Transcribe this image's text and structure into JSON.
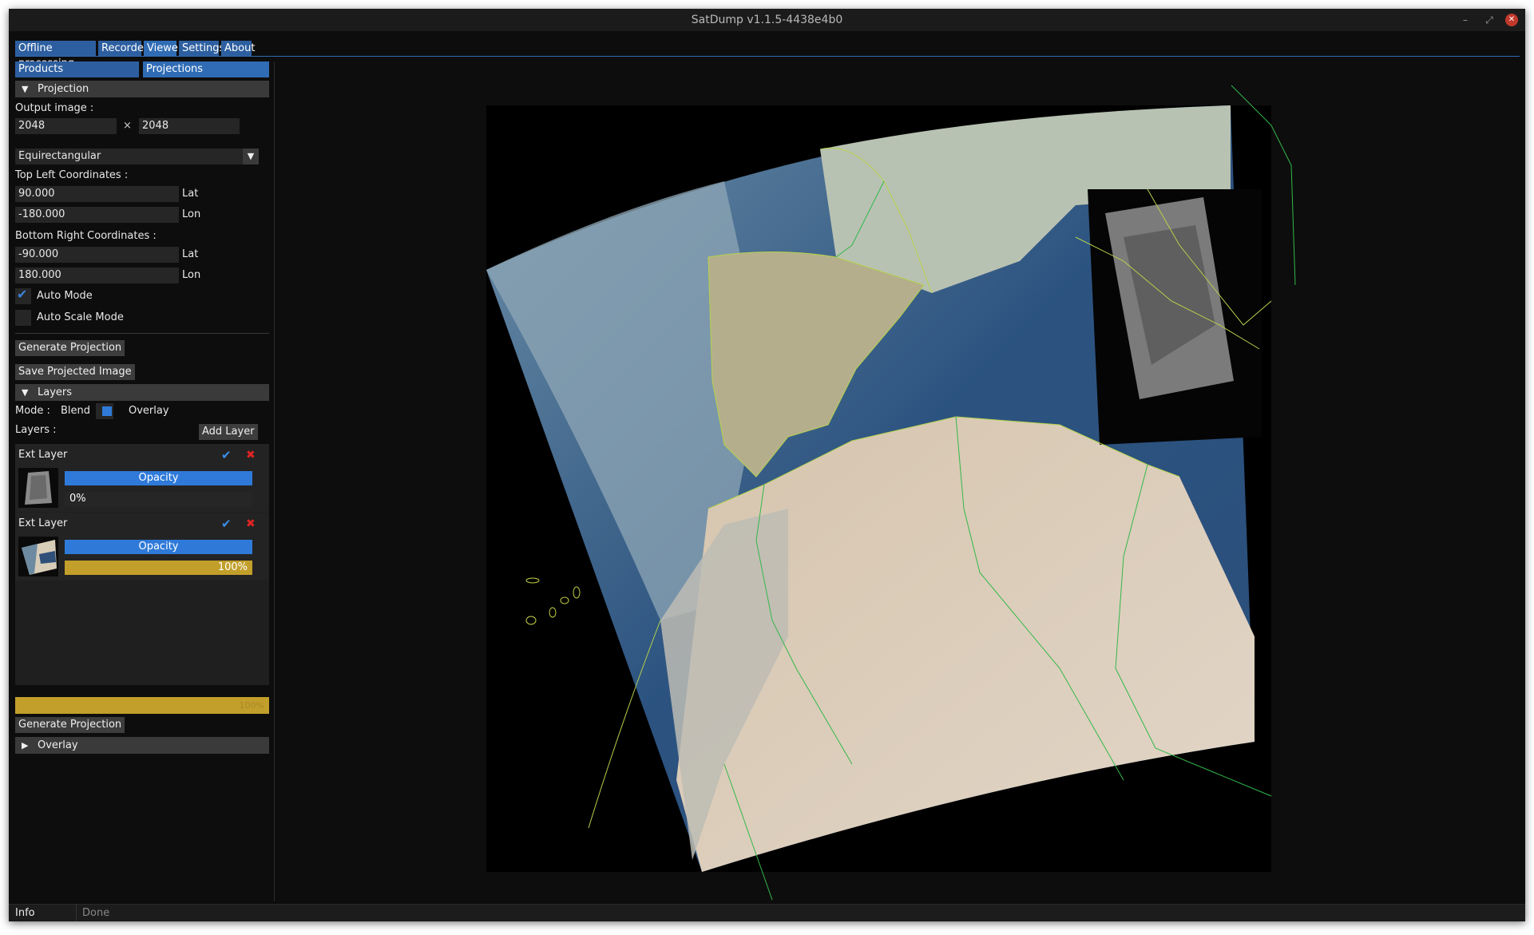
{
  "window": {
    "title": "SatDump v1.1.5-4438e4b0"
  },
  "titlebar_icons": {
    "minimize": "minimize-icon",
    "maximize": "restore-icon",
    "close": "close-icon"
  },
  "tabs": [
    "Offline processing",
    "Recorder",
    "Viewer",
    "Settings",
    "About"
  ],
  "subtabs": [
    "Products",
    "Projections"
  ],
  "projection": {
    "header": "Projection",
    "output_label": "Output image :",
    "width": "2048",
    "times": "×",
    "height": "2048",
    "type": "Equirectangular",
    "top_left_label": "Top Left Coordinates :",
    "tl_lat": "90.000",
    "tl_lon": "-180.000",
    "bottom_right_label": "Bottom Right Coordinates :",
    "br_lat": "-90.000",
    "br_lon": "180.000",
    "lat_label": "Lat",
    "lon_label": "Lon",
    "auto_mode": "Auto Mode",
    "auto_mode_checked": true,
    "auto_scale_mode": "Auto Scale Mode",
    "auto_scale_checked": false,
    "generate_button": "Generate Projection",
    "save_button": "Save Projected Image"
  },
  "layers": {
    "header": "Layers",
    "mode_label": "Mode :",
    "mode_blend": "Blend",
    "mode_overlay": "Overlay",
    "layers_label": "Layers :",
    "add_button": "Add Layer",
    "items": [
      {
        "name": "Ext Layer",
        "opacity_label": "Opacity",
        "value": "0%",
        "fraction": 0.0
      },
      {
        "name": "Ext Layer",
        "opacity_label": "Opacity",
        "value": "100%",
        "fraction": 1.0
      }
    ]
  },
  "progress": {
    "value": "100%",
    "fraction": 1.0
  },
  "bottom": {
    "generate_button": "Generate Projection",
    "overlay_header": "Overlay"
  },
  "status": {
    "label": "Info",
    "message": "Done"
  },
  "colors": {
    "accent": "#2f6cb5",
    "progress": "#c29f2a",
    "close": "#c0392b"
  }
}
